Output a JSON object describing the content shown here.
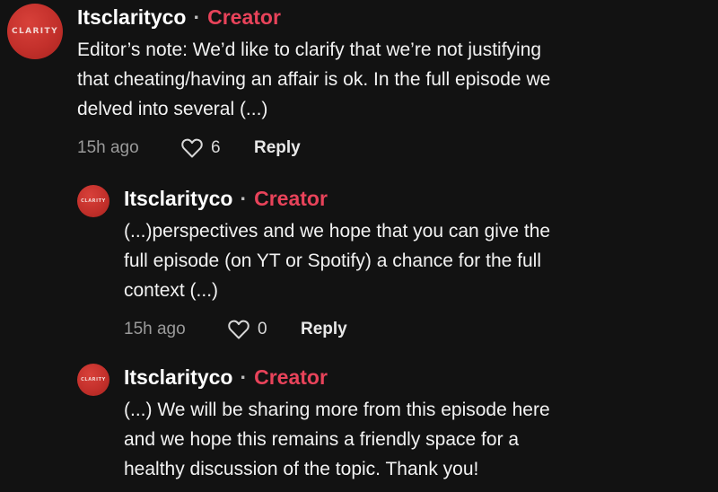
{
  "avatar_text": "CLARITY",
  "comments": [
    {
      "username": "Itsclarityco",
      "separator": "·",
      "badge": "Creator",
      "text_lines": [
        "Editor’s note: We’d like to clarify that we’re not justifying",
        "that cheating/having an affair is ok. In the full episode we",
        "delved into several (...)"
      ],
      "time": "15h ago",
      "likes": "6",
      "reply_label": "Reply"
    },
    {
      "username": "Itsclarityco",
      "separator": "·",
      "badge": "Creator",
      "text_lines": [
        "(...)perspectives and we hope that you can give the",
        "full episode (on YT or Spotify) a chance for the full",
        "context (...)"
      ],
      "time": "15h ago",
      "likes": "0",
      "reply_label": "Reply"
    },
    {
      "username": "Itsclarityco",
      "separator": "·",
      "badge": "Creator",
      "text_lines": [
        "(...) We will be sharing more from this episode here",
        "and we hope this remains a friendly space for a",
        "healthy discussion of the topic. Thank you!"
      ]
    }
  ],
  "colors": {
    "background": "#121212",
    "creator_badge": "#e8435a",
    "avatar": "#c3302b"
  },
  "icons": {
    "like": "heart-outline-icon"
  }
}
